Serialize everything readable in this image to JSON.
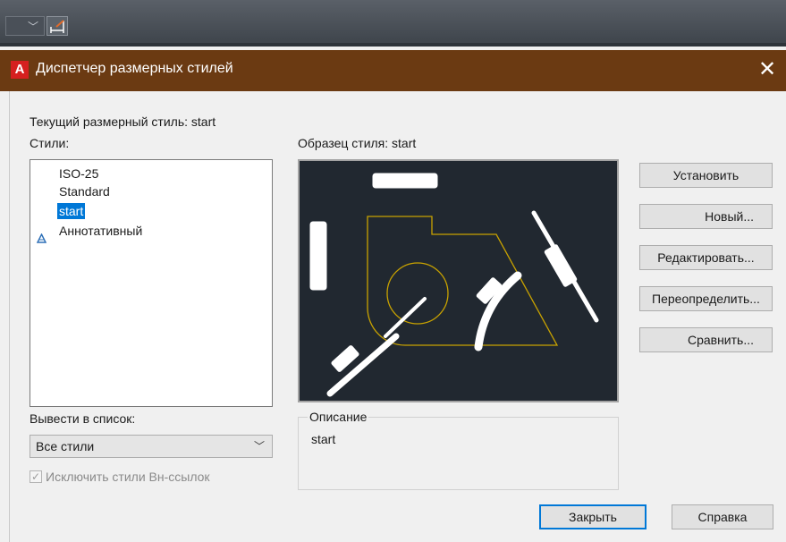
{
  "dialog": {
    "title": "Диспетчер размерных стилей",
    "close_glyph": "✕"
  },
  "current_style": "Текущий размерный стиль: start",
  "styles_label": "Стили:",
  "styles": [
    {
      "label": "ISO-25",
      "selected": false,
      "annotative": false
    },
    {
      "label": "Standard",
      "selected": false,
      "annotative": false
    },
    {
      "label": "start",
      "selected": true,
      "annotative": false
    },
    {
      "label": "Аннотативный",
      "selected": false,
      "annotative": true
    }
  ],
  "preview_label": "Образец стиля: start",
  "description": {
    "legend": "Описание",
    "text": "start"
  },
  "list_filter": {
    "label": "Вывести в список:",
    "value": "Все стили"
  },
  "exclude_xrefs": {
    "label": "Исключить стили Вн-ссылок",
    "checked": true
  },
  "buttons": {
    "set_current": "Установить",
    "new": "Новый...",
    "modify": "Редактировать...",
    "override": "Переопределить...",
    "compare": "Сравнить...",
    "close": "Закрыть",
    "help": "Справка"
  },
  "icons": {
    "app": "autocad-a-icon",
    "annotative": "annotative-triangle-icon",
    "dimension_tool": "linear-dimension-icon"
  },
  "colors": {
    "titlebar": "#6b3a12",
    "selection": "#0078d7",
    "preview_bg": "#212830",
    "preview_geometry": "#c8a200"
  }
}
